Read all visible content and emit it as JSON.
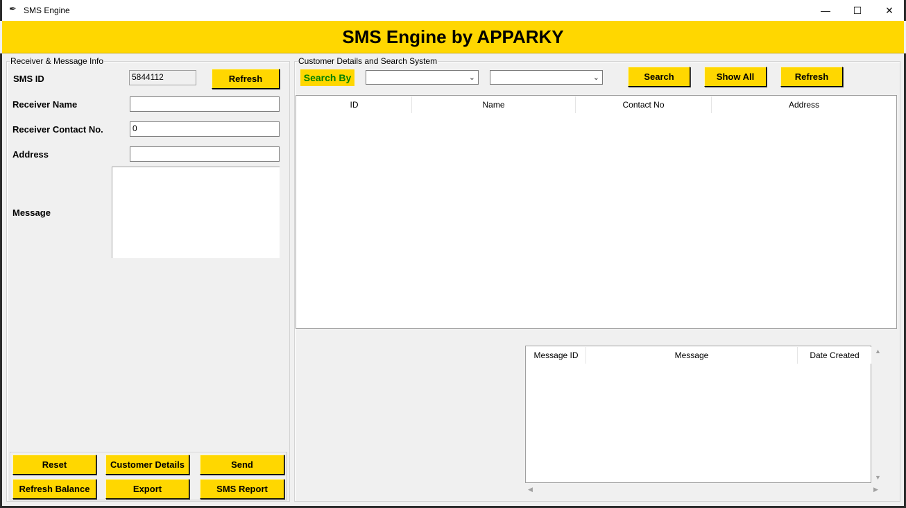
{
  "window": {
    "title": "SMS Engine",
    "minimize": "—",
    "maximize": "☐",
    "close": "✕"
  },
  "banner": {
    "title": "SMS Engine by APPARKY"
  },
  "left": {
    "group_title": "Receiver & Message Info",
    "sms_id_label": "SMS ID",
    "sms_id_value": "5844112",
    "refresh_label": "Refresh",
    "receiver_name_label": "Receiver Name",
    "receiver_name_value": "",
    "contact_label": "Receiver Contact No.",
    "contact_value": "0",
    "address_label": "Address",
    "address_value": "",
    "message_label": "Message",
    "buttons": {
      "reset": "Reset",
      "customer_details": "Customer Details",
      "send": "Send",
      "refresh_balance": "Refresh Balance",
      "export": "Export",
      "sms_report": "SMS Report"
    }
  },
  "right": {
    "group_title": "Customer Details and Search System",
    "search_by_label": "Search By",
    "search_field_value": "",
    "search_text_value": "",
    "search_button": "Search",
    "show_all_button": "Show All",
    "refresh_button": "Refresh",
    "customer_table": {
      "columns": [
        "ID",
        "Name",
        "Contact No",
        "Address"
      ],
      "rows": []
    },
    "message_table": {
      "columns": [
        "Message ID",
        "Message",
        "Date Created"
      ],
      "rows": []
    }
  },
  "icons": {
    "app": "feather-icon",
    "combo": "chevron-down-icon"
  },
  "colors": {
    "accent": "#ffd700",
    "search_by_text": "#008000"
  }
}
